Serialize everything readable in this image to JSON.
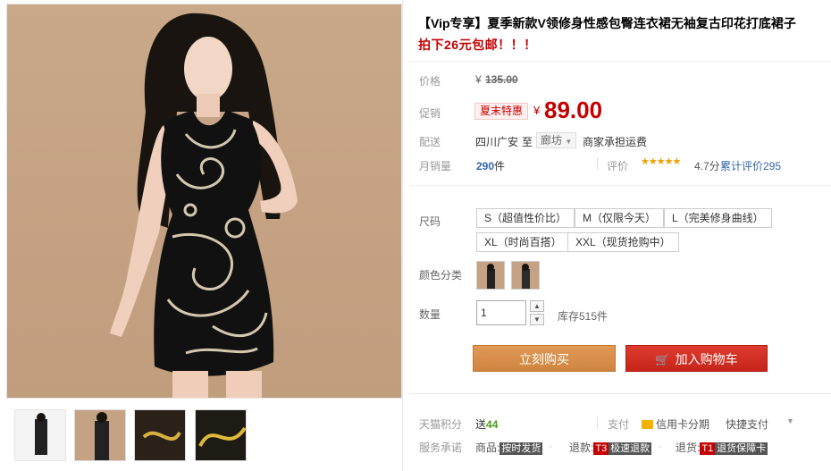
{
  "product": {
    "title": "【Vip专享】夏季新款V领修身性感包臀连衣裙无袖复古印花打底裙子",
    "subtitle": "拍下26元包邮！！！"
  },
  "price": {
    "label": "价格",
    "currency": "¥",
    "original": "135.00"
  },
  "promo": {
    "label": "促销",
    "badge": "夏末特惠",
    "currency": "¥",
    "price": "89.00"
  },
  "delivery": {
    "label": "配送",
    "origin": "四川广安",
    "to": "至",
    "destination": "廊坊",
    "shipping": "商家承担运费"
  },
  "sales": {
    "label": "月销量",
    "count": "290",
    "unit": "件",
    "rating_label": "评价",
    "stars": "★★★★★",
    "rating": "4.7分",
    "reviews": "累计评价295"
  },
  "size": {
    "label": "尺码",
    "options": [
      "S（超值性价比）",
      "M（仅限今天）",
      "L（完美修身曲线）",
      "XL（时尚百搭）",
      "XXL（现货抢购中）"
    ]
  },
  "color": {
    "label": "颜色分类"
  },
  "quantity": {
    "label": "数量",
    "value": "1",
    "stock": "库存515件"
  },
  "actions": {
    "buy_now": "立刻购买",
    "add_to_cart": "加入购物车"
  },
  "points": {
    "label": "天猫积分",
    "value_prefix": "送",
    "value": "44",
    "pay_label": "支付",
    "credit": "信用卡分期",
    "fast_pay": "快捷支付"
  },
  "service": {
    "label": "服务承诺",
    "item1_prefix": "商品:",
    "item1_tag": "按时发货",
    "item2_prefix": "退款:",
    "item2_tag_a": "T3",
    "item2_tag_b": "极速退款",
    "item3_prefix": "退货:",
    "item3_tag_a": "T1",
    "item3_tag_b": "退货保障卡"
  },
  "colors": {
    "accent": "#c40000",
    "buy_button": "#d8914b",
    "cart_button": "#c7251a",
    "background_photo": "#c4a283"
  }
}
